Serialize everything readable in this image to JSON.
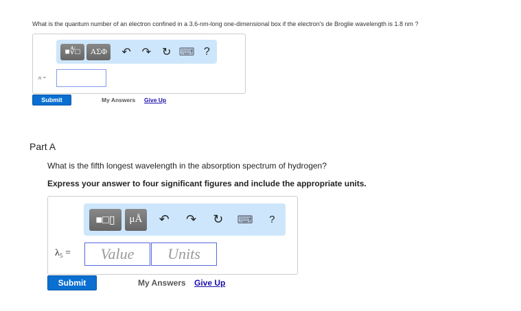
{
  "question1": {
    "text": "What is the quantum number of an electron confined in a 3.6-nm-long one-dimensional box if the electron's de Broglie wavelength is 1.8 nm ?",
    "toolbar": {
      "template_icon": "■∜□",
      "greek_label": "ΑΣΦ",
      "undo": "↶",
      "redo": "↷",
      "reset": "↻",
      "keyboard": "⌨",
      "help": "?"
    },
    "var_label": "n =",
    "submit": "Submit",
    "my_answers": "My Answers",
    "give_up": "Give Up"
  },
  "partA": {
    "title": "Part A",
    "question": "What is the fifth longest wavelength in the absorption spectrum of hydrogen?",
    "instruction": "Express your answer to four significant figures and include the appropriate units.",
    "toolbar": {
      "template_icon": "■□▯",
      "units_label": "μÅ",
      "undo": "↶",
      "redo": "↷",
      "reset": "↻",
      "keyboard": "⌨",
      "help": "?"
    },
    "var_label": "λ₅ =",
    "value_placeholder": "Value",
    "units_placeholder": "Units",
    "submit": "Submit",
    "my_answers": "My Answers",
    "give_up": "Give Up"
  }
}
